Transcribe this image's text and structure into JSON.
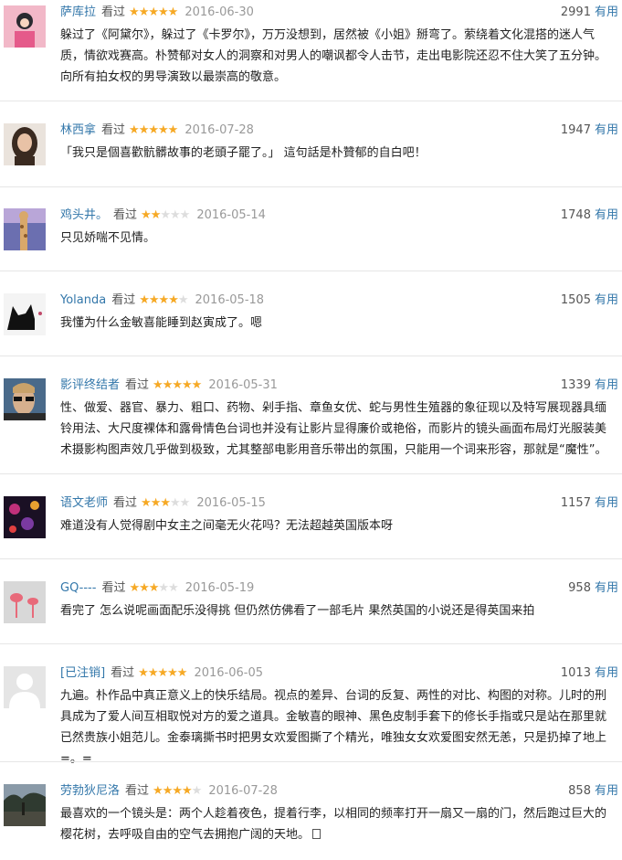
{
  "useful_label": "有用",
  "seen_label": "看过",
  "colors": {
    "link": "#3377aa",
    "star": "#f6a925",
    "star_empty": "#dddddd"
  },
  "comments": [
    {
      "user": "萨库拉",
      "rating": 5,
      "date": "2016-06-30",
      "votes": "2991",
      "avatar_icon": "avatar-pink-photo",
      "text": "躲过了《阿黛尔》，躲过了《卡罗尔》，万万没想到，居然被《小姐》掰弯了。萦绕着文化混搭的迷人气质，情欲戏赛高。朴赞郁对女人的洞察和对男人的嘲讽都令人击节，走出电影院还忍不住大笑了五分钟。向所有拍女权的男导演致以最崇高的敬意。"
    },
    {
      "user": "林西拿",
      "rating": 5,
      "date": "2016-07-28",
      "votes": "1947",
      "avatar_icon": "avatar-girl-photo",
      "text": "「我只是個喜歡骯髒故事的老頭子罷了。」 這句話是朴贊郁的自白吧！"
    },
    {
      "user": "鸡头井。",
      "rating": 2,
      "date": "2016-05-14",
      "votes": "1748",
      "avatar_icon": "avatar-giraffe-photo",
      "text": "只见娇喘不见情。"
    },
    {
      "user": "Yolanda",
      "rating": 4,
      "date": "2016-05-18",
      "votes": "1505",
      "avatar_icon": "avatar-black-cat-photo",
      "text": "我懂为什么金敏喜能睡到赵寅成了。嗯"
    },
    {
      "user": "影评终结者",
      "rating": 5,
      "date": "2016-05-31",
      "votes": "1339",
      "avatar_icon": "avatar-man-sunglasses-photo",
      "text": "性、做爱、器官、暴力、粗口、药物、剁手指、章鱼女优、蛇与男性生殖器的象征现以及特写展现器具缅铃用法、大尺度裸体和露骨情色台词也并没有让影片显得廉价或艳俗，而影片的镜头画面布局灯光服装美术摄影构图声效几乎做到极致，尤其整部电影用音乐带出的氛围，只能用一个词来形容，那就是“魔性”。"
    },
    {
      "user": "语文老师",
      "rating": 3,
      "date": "2016-05-15",
      "votes": "1157",
      "avatar_icon": "avatar-stage-lights-photo",
      "text": "难道没有人觉得剧中女主之间毫无火花吗？无法超越英国版本呀"
    },
    {
      "user": "GQ----",
      "rating": 3,
      "date": "2016-05-19",
      "votes": "958",
      "avatar_icon": "avatar-flamingo-photo",
      "text": "看完了 怎么说呢画面配乐没得挑 但仍然仿佛看了一部毛片 果然英国的小说还是得英国来拍"
    },
    {
      "user": "[已注销]",
      "rating": 5,
      "date": "2016-06-05",
      "votes": "1013",
      "avatar_icon": "avatar-default-user",
      "text": "九遍。朴作品中真正意义上的快乐结局。视点的差异、台词的反复、两性的对比、构图的对称。儿时的刑具成为了爱人间互相取悦对方的爱之道具。金敏喜的眼神、黑色皮制手套下的修长手指或只是站在那里就已然贵族小姐范儿。金泰璃撕书时把男女欢爱图撕了个精光，唯独女女欢爱图安然无恙，只是扔掉了地上=。="
    },
    {
      "user": "劳勃狄尼洛",
      "rating": 4,
      "date": "2016-07-28",
      "votes": "858",
      "avatar_icon": "avatar-tree-landscape-photo",
      "text": "最喜欢的一个镜头是：两个人趁着夜色，提着行李，以相同的频率打开一扇又一扇的门，然后跑过巨大的樱花树，去呼吸自由的空气去拥抱广阔的天地。"
    }
  ]
}
